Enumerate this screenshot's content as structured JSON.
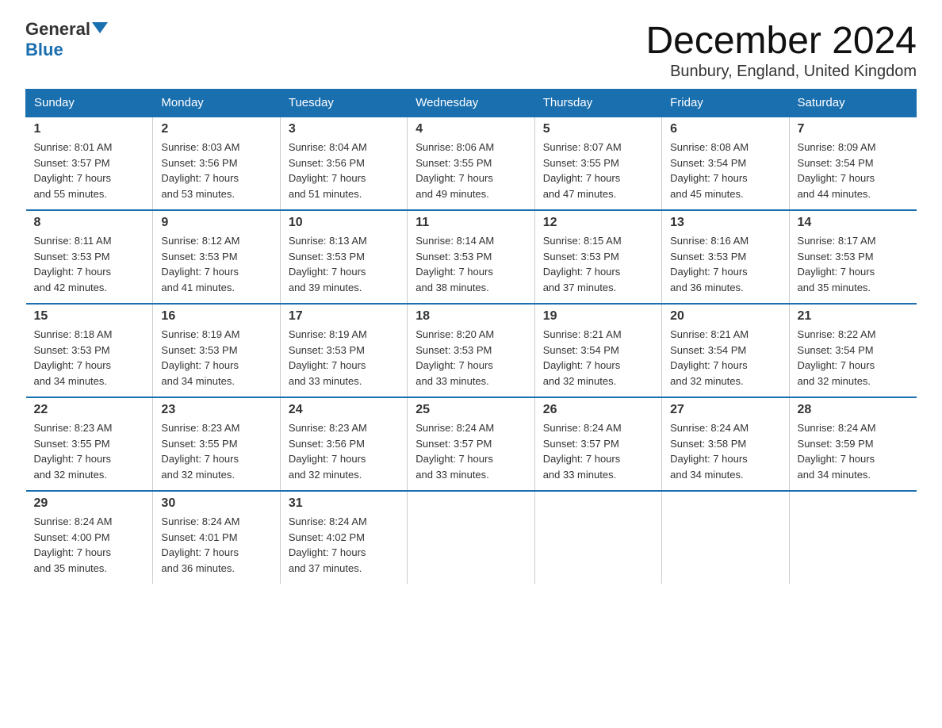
{
  "header": {
    "logo_general": "General",
    "logo_blue": "Blue",
    "month_title": "December 2024",
    "location": "Bunbury, England, United Kingdom"
  },
  "columns": [
    "Sunday",
    "Monday",
    "Tuesday",
    "Wednesday",
    "Thursday",
    "Friday",
    "Saturday"
  ],
  "weeks": [
    [
      {
        "day": "1",
        "info": "Sunrise: 8:01 AM\nSunset: 3:57 PM\nDaylight: 7 hours\nand 55 minutes."
      },
      {
        "day": "2",
        "info": "Sunrise: 8:03 AM\nSunset: 3:56 PM\nDaylight: 7 hours\nand 53 minutes."
      },
      {
        "day": "3",
        "info": "Sunrise: 8:04 AM\nSunset: 3:56 PM\nDaylight: 7 hours\nand 51 minutes."
      },
      {
        "day": "4",
        "info": "Sunrise: 8:06 AM\nSunset: 3:55 PM\nDaylight: 7 hours\nand 49 minutes."
      },
      {
        "day": "5",
        "info": "Sunrise: 8:07 AM\nSunset: 3:55 PM\nDaylight: 7 hours\nand 47 minutes."
      },
      {
        "day": "6",
        "info": "Sunrise: 8:08 AM\nSunset: 3:54 PM\nDaylight: 7 hours\nand 45 minutes."
      },
      {
        "day": "7",
        "info": "Sunrise: 8:09 AM\nSunset: 3:54 PM\nDaylight: 7 hours\nand 44 minutes."
      }
    ],
    [
      {
        "day": "8",
        "info": "Sunrise: 8:11 AM\nSunset: 3:53 PM\nDaylight: 7 hours\nand 42 minutes."
      },
      {
        "day": "9",
        "info": "Sunrise: 8:12 AM\nSunset: 3:53 PM\nDaylight: 7 hours\nand 41 minutes."
      },
      {
        "day": "10",
        "info": "Sunrise: 8:13 AM\nSunset: 3:53 PM\nDaylight: 7 hours\nand 39 minutes."
      },
      {
        "day": "11",
        "info": "Sunrise: 8:14 AM\nSunset: 3:53 PM\nDaylight: 7 hours\nand 38 minutes."
      },
      {
        "day": "12",
        "info": "Sunrise: 8:15 AM\nSunset: 3:53 PM\nDaylight: 7 hours\nand 37 minutes."
      },
      {
        "day": "13",
        "info": "Sunrise: 8:16 AM\nSunset: 3:53 PM\nDaylight: 7 hours\nand 36 minutes."
      },
      {
        "day": "14",
        "info": "Sunrise: 8:17 AM\nSunset: 3:53 PM\nDaylight: 7 hours\nand 35 minutes."
      }
    ],
    [
      {
        "day": "15",
        "info": "Sunrise: 8:18 AM\nSunset: 3:53 PM\nDaylight: 7 hours\nand 34 minutes."
      },
      {
        "day": "16",
        "info": "Sunrise: 8:19 AM\nSunset: 3:53 PM\nDaylight: 7 hours\nand 34 minutes."
      },
      {
        "day": "17",
        "info": "Sunrise: 8:19 AM\nSunset: 3:53 PM\nDaylight: 7 hours\nand 33 minutes."
      },
      {
        "day": "18",
        "info": "Sunrise: 8:20 AM\nSunset: 3:53 PM\nDaylight: 7 hours\nand 33 minutes."
      },
      {
        "day": "19",
        "info": "Sunrise: 8:21 AM\nSunset: 3:54 PM\nDaylight: 7 hours\nand 32 minutes."
      },
      {
        "day": "20",
        "info": "Sunrise: 8:21 AM\nSunset: 3:54 PM\nDaylight: 7 hours\nand 32 minutes."
      },
      {
        "day": "21",
        "info": "Sunrise: 8:22 AM\nSunset: 3:54 PM\nDaylight: 7 hours\nand 32 minutes."
      }
    ],
    [
      {
        "day": "22",
        "info": "Sunrise: 8:23 AM\nSunset: 3:55 PM\nDaylight: 7 hours\nand 32 minutes."
      },
      {
        "day": "23",
        "info": "Sunrise: 8:23 AM\nSunset: 3:55 PM\nDaylight: 7 hours\nand 32 minutes."
      },
      {
        "day": "24",
        "info": "Sunrise: 8:23 AM\nSunset: 3:56 PM\nDaylight: 7 hours\nand 32 minutes."
      },
      {
        "day": "25",
        "info": "Sunrise: 8:24 AM\nSunset: 3:57 PM\nDaylight: 7 hours\nand 33 minutes."
      },
      {
        "day": "26",
        "info": "Sunrise: 8:24 AM\nSunset: 3:57 PM\nDaylight: 7 hours\nand 33 minutes."
      },
      {
        "day": "27",
        "info": "Sunrise: 8:24 AM\nSunset: 3:58 PM\nDaylight: 7 hours\nand 34 minutes."
      },
      {
        "day": "28",
        "info": "Sunrise: 8:24 AM\nSunset: 3:59 PM\nDaylight: 7 hours\nand 34 minutes."
      }
    ],
    [
      {
        "day": "29",
        "info": "Sunrise: 8:24 AM\nSunset: 4:00 PM\nDaylight: 7 hours\nand 35 minutes."
      },
      {
        "day": "30",
        "info": "Sunrise: 8:24 AM\nSunset: 4:01 PM\nDaylight: 7 hours\nand 36 minutes."
      },
      {
        "day": "31",
        "info": "Sunrise: 8:24 AM\nSunset: 4:02 PM\nDaylight: 7 hours\nand 37 minutes."
      },
      {
        "day": "",
        "info": ""
      },
      {
        "day": "",
        "info": ""
      },
      {
        "day": "",
        "info": ""
      },
      {
        "day": "",
        "info": ""
      }
    ]
  ]
}
